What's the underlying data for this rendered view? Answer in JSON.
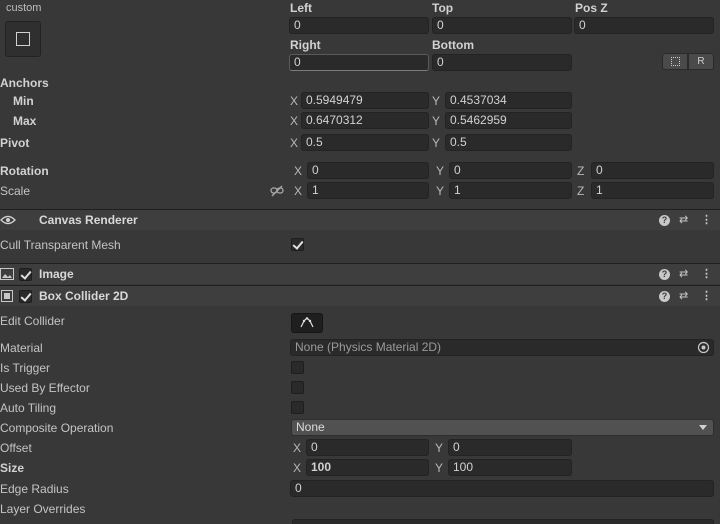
{
  "rect": {
    "preset_label": "custom",
    "left_label": "Left",
    "top_label": "Top",
    "posz_label": "Pos Z",
    "left": "0",
    "top": "0",
    "posz": "0",
    "right_label": "Right",
    "bottom_label": "Bottom",
    "right": "0",
    "bottom": "0",
    "r_button": "R"
  },
  "anchors": {
    "label": "Anchors",
    "min_label": "Min",
    "max_label": "Max",
    "min_x": "0.5949479",
    "min_y": "0.4537034",
    "max_x": "0.6470312",
    "max_y": "0.5462959"
  },
  "pivot": {
    "label": "Pivot",
    "x": "0.5",
    "y": "0.5"
  },
  "rotation": {
    "label": "Rotation",
    "x": "0",
    "y": "0",
    "z": "0"
  },
  "scale": {
    "label": "Scale",
    "x": "1",
    "y": "1",
    "z": "1"
  },
  "axes": {
    "x": "X",
    "y": "Y",
    "z": "Z"
  },
  "canvas_renderer": {
    "title": "Canvas Renderer",
    "cull_label": "Cull Transparent Mesh",
    "cull_checked": true
  },
  "image": {
    "title": "Image",
    "enabled": true
  },
  "box_collider": {
    "title": "Box Collider 2D",
    "enabled": true,
    "edit_collider_label": "Edit Collider",
    "material_label": "Material",
    "material_value": "None (Physics Material 2D)",
    "is_trigger_label": "Is Trigger",
    "used_by_effector_label": "Used By Effector",
    "auto_tiling_label": "Auto Tiling",
    "composite_label": "Composite Operation",
    "composite_value": "None",
    "offset_label": "Offset",
    "offset_x": "0",
    "offset_y": "0",
    "size_label": "Size",
    "size_x": "100",
    "size_y": "100",
    "edge_radius_label": "Edge Radius",
    "edge_radius": "0",
    "layer_overrides_label": "Layer Overrides"
  },
  "icons": [
    "eye-icon",
    "image-component-icon",
    "box-collider-icon",
    "help-icon",
    "preset-sliders-icon",
    "kebab-menu-icon",
    "link-icon",
    "edit-collider-icon",
    "object-picker-icon",
    "dropdown-arrow-icon",
    "blueprint-icon"
  ]
}
